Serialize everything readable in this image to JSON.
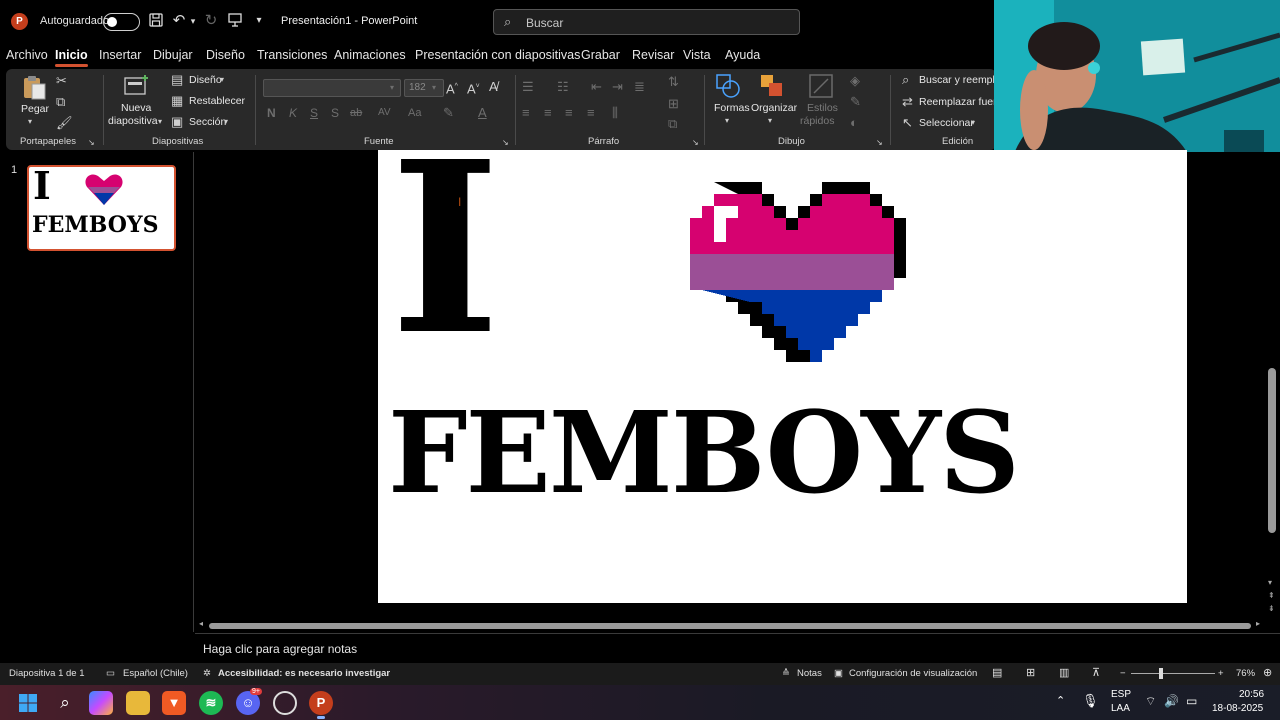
{
  "titlebar": {
    "app_logo": "P",
    "autosave_label": "Autoguardado",
    "doc_title": "Presentación1  -  PowerPoint",
    "search_placeholder": "Buscar"
  },
  "menu": {
    "tabs": [
      "Archivo",
      "Inicio",
      "Insertar",
      "Dibujar",
      "Diseño",
      "Transiciones",
      "Animaciones",
      "Presentación con diapositivas",
      "Grabar",
      "Revisar",
      "Vista",
      "Ayuda"
    ],
    "active": "Inicio"
  },
  "ribbon": {
    "clipboard": {
      "paste": "Pegar",
      "group": "Portapapeles"
    },
    "slides": {
      "new_slide": "Nueva",
      "new_slide_2": "diapositiva",
      "layout": "Diseño",
      "reset": "Restablecer",
      "section": "Sección",
      "group": "Diapositivas"
    },
    "font": {
      "size": "182",
      "group": "Fuente",
      "bold": "N",
      "italic": "K",
      "underline": "S",
      "shadow": "S",
      "strike": "ab",
      "spacing": "AV",
      "case": "Aa"
    },
    "paragraph": {
      "group": "Párrafo"
    },
    "drawing": {
      "shapes": "Formas",
      "arrange": "Organizar",
      "quick_styles": "Estilos",
      "quick_styles_2": "rápidos",
      "group": "Dibujo"
    },
    "editing": {
      "find": "Buscar y reempla",
      "replace": "Reemplazar fuen",
      "select": "Seleccionar",
      "group": "Edición"
    }
  },
  "thumbnails": [
    {
      "number": "1",
      "line1": "I",
      "line2": "FEMBOYS"
    }
  ],
  "slide": {
    "letter": "I",
    "word": "FEMBOYS",
    "heart_colors": {
      "top": "#d60270",
      "middle": "#9b4f96",
      "bottom": "#0038a8"
    }
  },
  "notes": {
    "placeholder": "Haga clic para agregar notas"
  },
  "statusbar": {
    "slide_info": "Diapositiva 1 de 1",
    "language": "Español (Chile)",
    "accessibility": "Accesibilidad: es necesario investigar",
    "notes": "Notas",
    "view_settings": "Configuración de visualización",
    "zoom": "76%"
  },
  "taskbar": {
    "language": "ESP",
    "layout": "LAA",
    "time": "20:56",
    "date": "18-08-2025",
    "discord_badge": "9+"
  }
}
